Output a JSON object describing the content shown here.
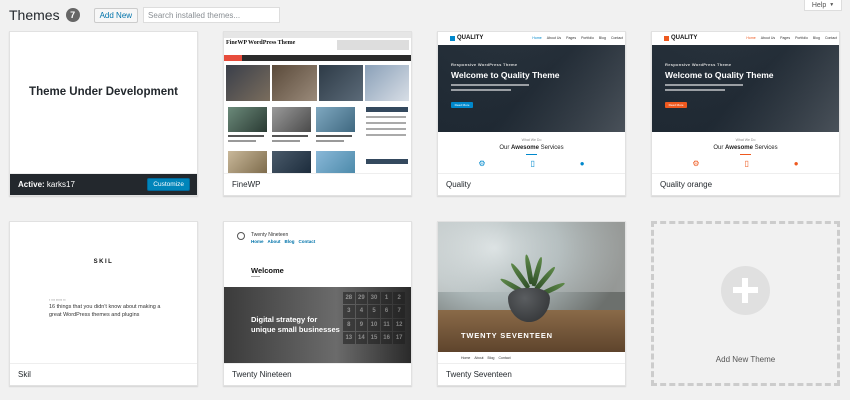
{
  "header": {
    "title": "Themes",
    "count": "7",
    "add_new_label": "Add New",
    "search_placeholder": "Search installed themes..."
  },
  "help": {
    "label": "Help",
    "arrow": "▼"
  },
  "themes": [
    {
      "name": "karks17",
      "active_prefix": "Active:",
      "customize_label": "Customize",
      "screenshot_text": "Theme Under Development"
    },
    {
      "name": "FineWP",
      "screenshot_text": "FineWP WordPress Theme"
    },
    {
      "name": "Quality",
      "logo_text": "QUALITY",
      "nav_items": [
        "Home",
        "About Us",
        "Pages",
        "Portfolio",
        "Blog",
        "Contact"
      ],
      "hero_subtitle": "Responsive WordPress Theme",
      "hero_title": "Welcome to Quality Theme",
      "hero_button": "Read More",
      "section_small": "What We Do",
      "section_prefix": "Our",
      "section_bold": "Awesome",
      "section_suffix": "Services",
      "accent_color": "#0088cc",
      "icons": [
        "gears-icon",
        "mobile-icon",
        "users-icon"
      ]
    },
    {
      "name": "Quality orange",
      "logo_text": "QUALITY",
      "nav_items": [
        "Home",
        "About Us",
        "Pages",
        "Portfolio",
        "Blog",
        "Contact"
      ],
      "hero_subtitle": "Responsive WordPress Theme",
      "hero_title": "Welcome to Quality Theme",
      "hero_button": "Read More",
      "section_small": "What We Do",
      "section_prefix": "Our",
      "section_bold": "Awesome",
      "section_suffix": "Services",
      "accent_color": "#ee591f",
      "icons": [
        "gears-icon",
        "mobile-icon",
        "users-icon"
      ]
    },
    {
      "name": "Skil",
      "logo_text": "SKIL",
      "post_title": "16 things that you didn't know about making a great WordPress themes and plugins"
    },
    {
      "name": "Twenty Nineteen",
      "site_title": "Twenty Nineteen",
      "nav_items": [
        "Home",
        "About",
        "Blog",
        "Contact"
      ],
      "welcome": "Welcome",
      "tagline_line1": "Digital strategy for",
      "tagline_line2": "unique small businesses"
    },
    {
      "name": "Twenty Seventeen",
      "hero_title": "TWENTY SEVENTEEN",
      "nav_items": [
        "Home",
        "About",
        "Blog",
        "Contact"
      ]
    }
  ],
  "add_new_theme": {
    "label": "Add New Theme"
  }
}
